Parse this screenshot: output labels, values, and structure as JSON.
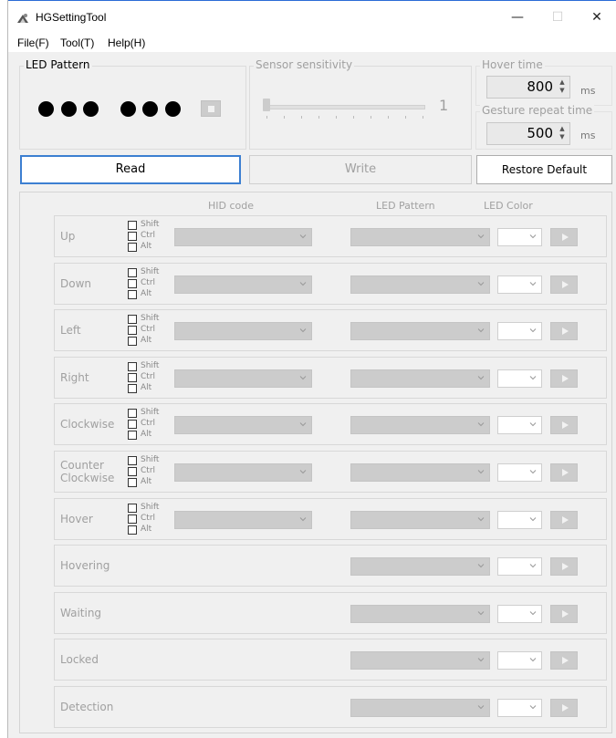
{
  "window": {
    "title": "HGSettingTool",
    "minimize": "—",
    "maximize": "☐",
    "close": "✕"
  },
  "menu": [
    {
      "label": "File(F)"
    },
    {
      "label": "Tool(T)"
    },
    {
      "label": "Help(H)"
    }
  ],
  "led_pattern": {
    "label": "LED Pattern"
  },
  "sensor": {
    "label": "Sensor sensitivity",
    "value": "1"
  },
  "hover_time": {
    "label": "Hover time",
    "value": "800",
    "unit": "ms"
  },
  "gesture_repeat": {
    "label": "Gesture repeat time",
    "value": "500",
    "unit": "ms"
  },
  "buttons": {
    "read": "Read",
    "write": "Write",
    "restore": "Restore Default"
  },
  "headers": {
    "hid": "HID code",
    "led_pattern": "LED Pattern",
    "led_color": "LED Color"
  },
  "modifiers": [
    "Shift",
    "Ctrl",
    "Alt"
  ],
  "rows": [
    {
      "label": "Up"
    },
    {
      "label": "Down"
    },
    {
      "label": "Left"
    },
    {
      "label": "Right"
    },
    {
      "label": "Clockwise"
    },
    {
      "label": "Counter Clockwise"
    },
    {
      "label": "Hover"
    },
    {
      "label": "Hovering"
    },
    {
      "label": "Waiting"
    },
    {
      "label": "Locked"
    },
    {
      "label": "Detection"
    }
  ]
}
